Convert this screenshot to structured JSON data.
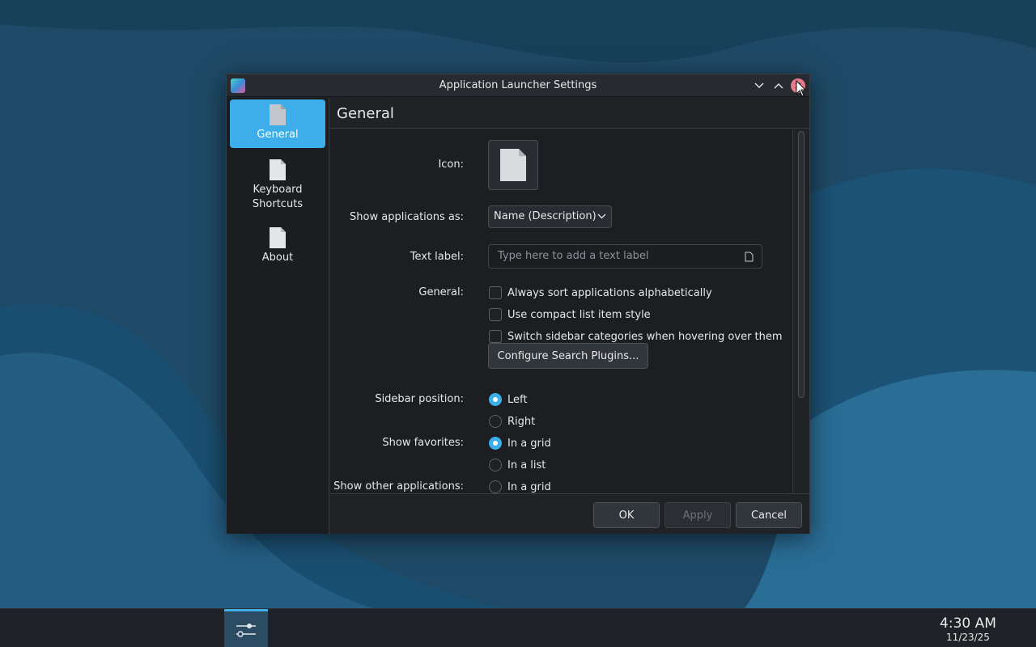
{
  "window": {
    "title": "Application Launcher Settings",
    "app_icon": "kde-launcher-settings-icon",
    "controls": [
      "chevron-down-icon",
      "chevron-up-icon",
      "close-icon"
    ]
  },
  "sidebar": {
    "items": [
      {
        "label": "General",
        "icon": "document-icon",
        "active": true
      },
      {
        "label": "Keyboard Shortcuts",
        "icon": "document-icon",
        "active": false
      },
      {
        "label": "About",
        "icon": "document-icon",
        "active": false
      }
    ]
  },
  "page": {
    "heading": "General",
    "icon_label": "Icon:",
    "show_apps_label": "Show applications as:",
    "show_apps_value": "Name (Description)",
    "text_label_label": "Text label:",
    "text_label_placeholder": "Type here to add a text label",
    "text_label_value": "",
    "general_label": "General:",
    "checkboxes": [
      {
        "label": "Always sort applications alphabetically",
        "checked": false
      },
      {
        "label": "Use compact list item style",
        "checked": false
      },
      {
        "label": "Switch sidebar categories when hovering over them",
        "checked": false
      }
    ],
    "configure_button": "Configure Search Plugins...",
    "sidebar_position_label": "Sidebar position:",
    "sidebar_position_options": [
      {
        "label": "Left",
        "selected": true
      },
      {
        "label": "Right",
        "selected": false
      }
    ],
    "show_favorites_label": "Show favorites:",
    "show_favorites_options": [
      {
        "label": "In a grid",
        "selected": true
      },
      {
        "label": "In a list",
        "selected": false
      }
    ],
    "show_other_label": "Show other applications:",
    "show_other_options": [
      {
        "label": "In a grid",
        "selected": false
      }
    ]
  },
  "footer": {
    "ok": "OK",
    "apply": "Apply",
    "cancel": "Cancel"
  },
  "taskbar": {
    "task_icon": "settings-sliders-icon",
    "time": "4:30 AM",
    "date": "11/23/25"
  },
  "colors": {
    "accent": "#3daee9",
    "window_bg": "#202326",
    "desktop": "#1e4a66"
  }
}
